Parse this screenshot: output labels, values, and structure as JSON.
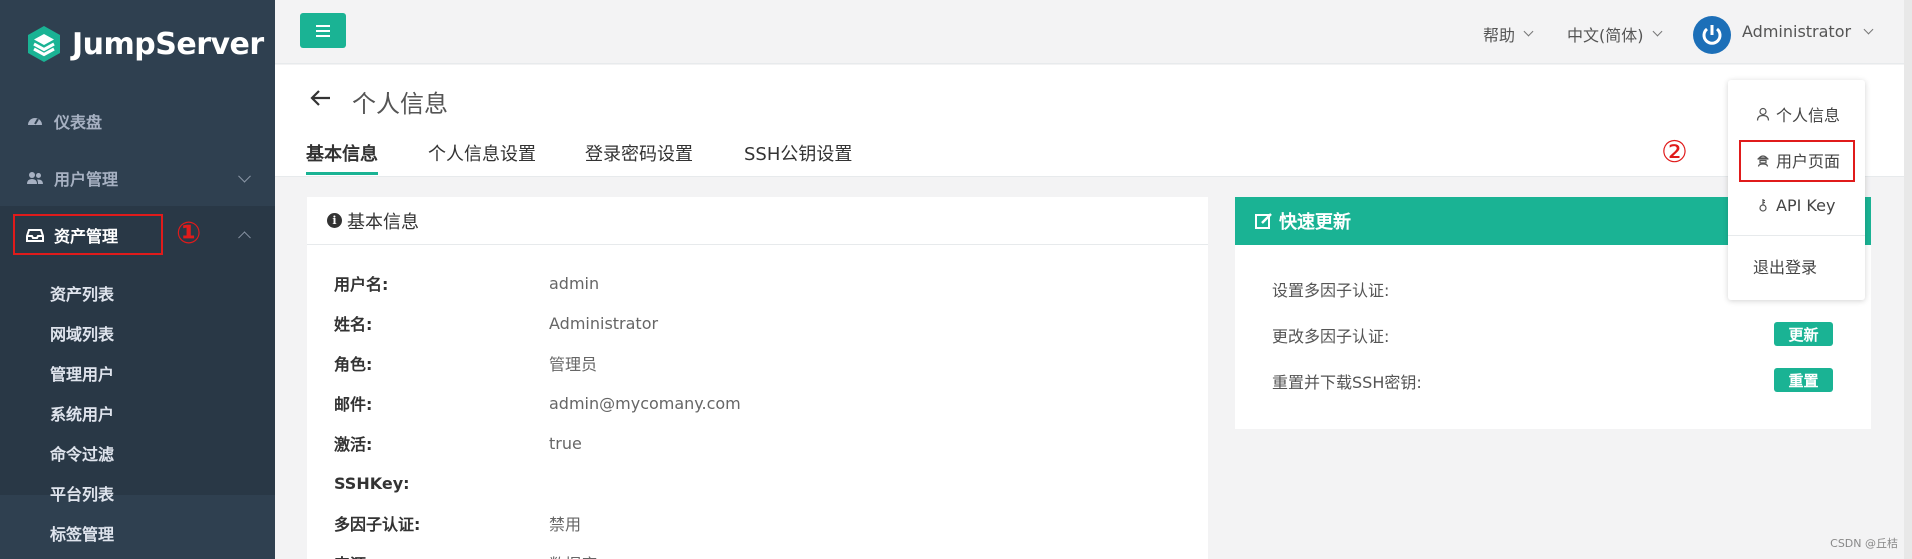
{
  "sidebar": {
    "logo_text": "JumpServer",
    "items": [
      {
        "label": "仪表盘",
        "icon": "dashboard-icon"
      },
      {
        "label": "用户管理",
        "icon": "users-icon"
      },
      {
        "label": "资产管理",
        "icon": "inbox-icon"
      }
    ],
    "asset_submenu": [
      "资产列表",
      "网域列表",
      "管理用户",
      "系统用户",
      "命令过滤",
      "平台列表",
      "标签管理"
    ],
    "annotation_1": "①"
  },
  "topbar": {
    "menu_icon": "hamburger-icon",
    "help_label": "帮助",
    "language_label": "中文(简体)",
    "user_name": "Administrator"
  },
  "page": {
    "title": "个人信息",
    "tabs": [
      "基本信息",
      "个人信息设置",
      "登录密码设置",
      "SSH公钥设置"
    ]
  },
  "basic_info": {
    "heading": "基本信息",
    "rows": [
      {
        "key": "用户名:",
        "value": "admin"
      },
      {
        "key": "姓名:",
        "value": "Administrator"
      },
      {
        "key": "角色:",
        "value": "管理员"
      },
      {
        "key": "邮件:",
        "value": "admin@mycomany.com"
      },
      {
        "key": "激活:",
        "value": "true"
      },
      {
        "key": "SSHKey:",
        "value": ""
      },
      {
        "key": "多因子认证:",
        "value": "禁用"
      },
      {
        "key": "来源:",
        "value": "数据库"
      }
    ]
  },
  "quick_update": {
    "heading": "快速更新",
    "rows": [
      {
        "label": "设置多因子认证:",
        "button": ""
      },
      {
        "label": "更改多因子认证:",
        "button": "更新"
      },
      {
        "label": "重置并下载SSH密钥:",
        "button": "重置"
      }
    ]
  },
  "user_menu": {
    "items": [
      "个人信息",
      "用户页面",
      "API Key",
      "退出登录"
    ],
    "annotation_2": "②"
  },
  "watermark": "CSDN @丘桔",
  "colors": {
    "accent": "#1ab394",
    "sidebar_bg": "#2f4050",
    "highlight_red": "#e01b1b",
    "avatar_blue": "#1c6fb8"
  }
}
